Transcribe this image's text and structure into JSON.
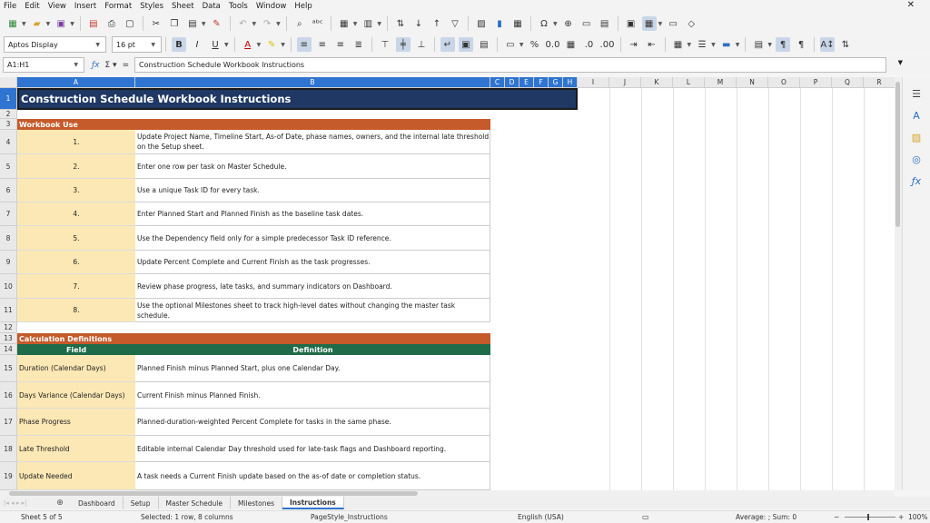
{
  "menu": [
    "File",
    "Edit",
    "View",
    "Insert",
    "Format",
    "Styles",
    "Sheet",
    "Data",
    "Tools",
    "Window",
    "Help"
  ],
  "font": {
    "name": "Aptos Display",
    "size": "16 pt"
  },
  "formula": {
    "cell_ref": "A1:H1",
    "content": "Construction Schedule Workbook Instructions"
  },
  "columns": [
    "A",
    "B",
    "C",
    "D",
    "E",
    "F",
    "G",
    "H",
    "I",
    "J",
    "K",
    "L",
    "M",
    "N",
    "O",
    "P",
    "Q",
    "R"
  ],
  "rows": [
    "1",
    "2",
    "3",
    "4",
    "5",
    "6",
    "7",
    "8",
    "9",
    "10",
    "11",
    "12",
    "13",
    "14",
    "15",
    "16",
    "17",
    "18",
    "19"
  ],
  "sheet": {
    "title": "Construction Schedule Workbook Instructions",
    "workbook_use_header": "Workbook Use",
    "workbook_use": [
      {
        "num": "1.",
        "text": "Update Project Name, Timeline Start, As-of Date, phase names, owners, and the internal late threshold on the Setup sheet."
      },
      {
        "num": "2.",
        "text": "Enter one row per task on Master Schedule."
      },
      {
        "num": "3.",
        "text": "Use a unique Task ID for every task."
      },
      {
        "num": "4.",
        "text": "Enter Planned Start and Planned Finish as the baseline task dates."
      },
      {
        "num": "5.",
        "text": "Use the Dependency field only for a simple predecessor Task ID reference."
      },
      {
        "num": "6.",
        "text": "Update Percent Complete and Current Finish as the task progresses."
      },
      {
        "num": "7.",
        "text": "Review phase progress, late tasks, and summary indicators on Dashboard."
      },
      {
        "num": "8.",
        "text": "Use the optional Milestones sheet to track high-level dates without changing the master task schedule."
      }
    ],
    "calc_header": "Calculation Definitions",
    "field_header": "Field",
    "definition_header": "Definition",
    "definitions": [
      {
        "field": "Duration (Calendar Days)",
        "definition": "Planned Finish minus Planned Start, plus one Calendar Day."
      },
      {
        "field": "Days Variance (Calendar Days)",
        "definition": "Current Finish minus Planned Finish."
      },
      {
        "field": "Phase Progress",
        "definition": "Planned-duration-weighted Percent Complete for tasks in the same phase."
      },
      {
        "field": "Late Threshold",
        "definition": "Editable internal Calendar Day threshold used for late-task flags and Dashboard reporting."
      },
      {
        "field": "Update Needed",
        "definition": "A task needs a Current Finish update based on the as-of date or completion status."
      }
    ]
  },
  "tabs": [
    "Dashboard",
    "Setup",
    "Master Schedule",
    "Milestones",
    "Instructions"
  ],
  "active_tab": "Instructions",
  "status": {
    "sheet": "Sheet 5 of 5",
    "selection": "Selected: 1 row, 8 columns",
    "page_style": "PageStyle_Instructions",
    "language": "English (USA)",
    "summary": "Average: ; Sum: 0",
    "zoom": "100%"
  },
  "colors": {
    "title_bg": "#1f3864",
    "section_bg": "#c55a2b",
    "header_bg": "#1e6b4a",
    "field_bg": "#fbe8b4",
    "selection": "#2f74d0"
  }
}
